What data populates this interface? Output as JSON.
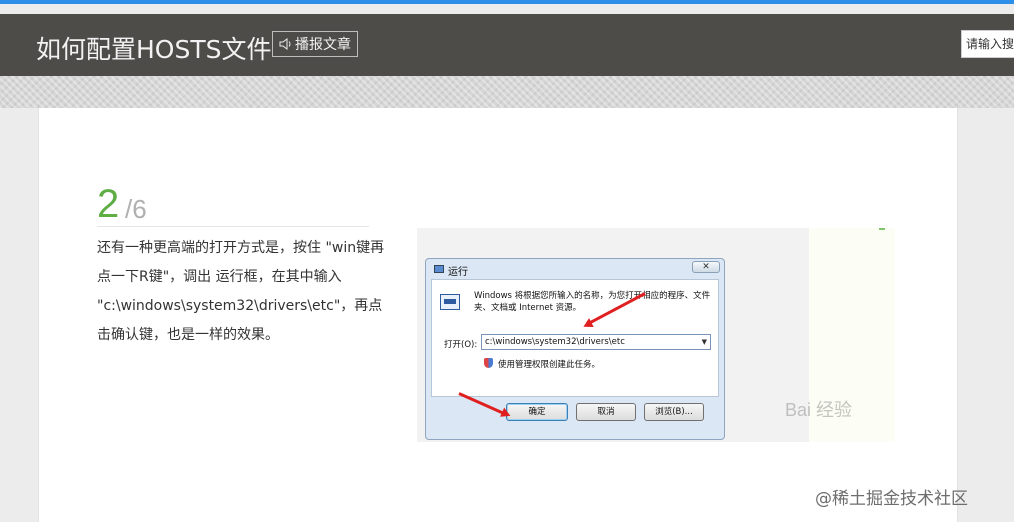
{
  "header": {
    "title": "如何配置HOSTS文件",
    "broadcast_label": "播报文章",
    "search_placeholder": "请输入搜"
  },
  "step": {
    "current": "2",
    "total": "/6"
  },
  "description": "还有一种更高端的打开方式是，按住 \"win键再点一下R键\"，调出 运行框，在其中输入 \"c:\\windows\\system32\\drivers\\etc\"，再点击确认键，也是一样的效果。",
  "screenshot": {
    "dialog_title": "运行",
    "close_label": "✕",
    "dialog_text": "Windows 将根据您所输入的名称，为您打开相应的程序、文件夹、文档或 Internet 资源。",
    "open_label": "打开(O):",
    "open_value": "c:\\windows\\system32\\drivers\\etc",
    "admin_text": "使用管理权限创建此任务。",
    "ok_label": "确定",
    "cancel_label": "取消",
    "browse_label": "浏览(B)...",
    "watermark": "Bai 经验"
  },
  "site_watermark": "@稀土掘金技术社区",
  "colors": {
    "accent_top": "#2e8fe8",
    "header_bg": "#4d4c49",
    "step_green": "#5eae45"
  }
}
